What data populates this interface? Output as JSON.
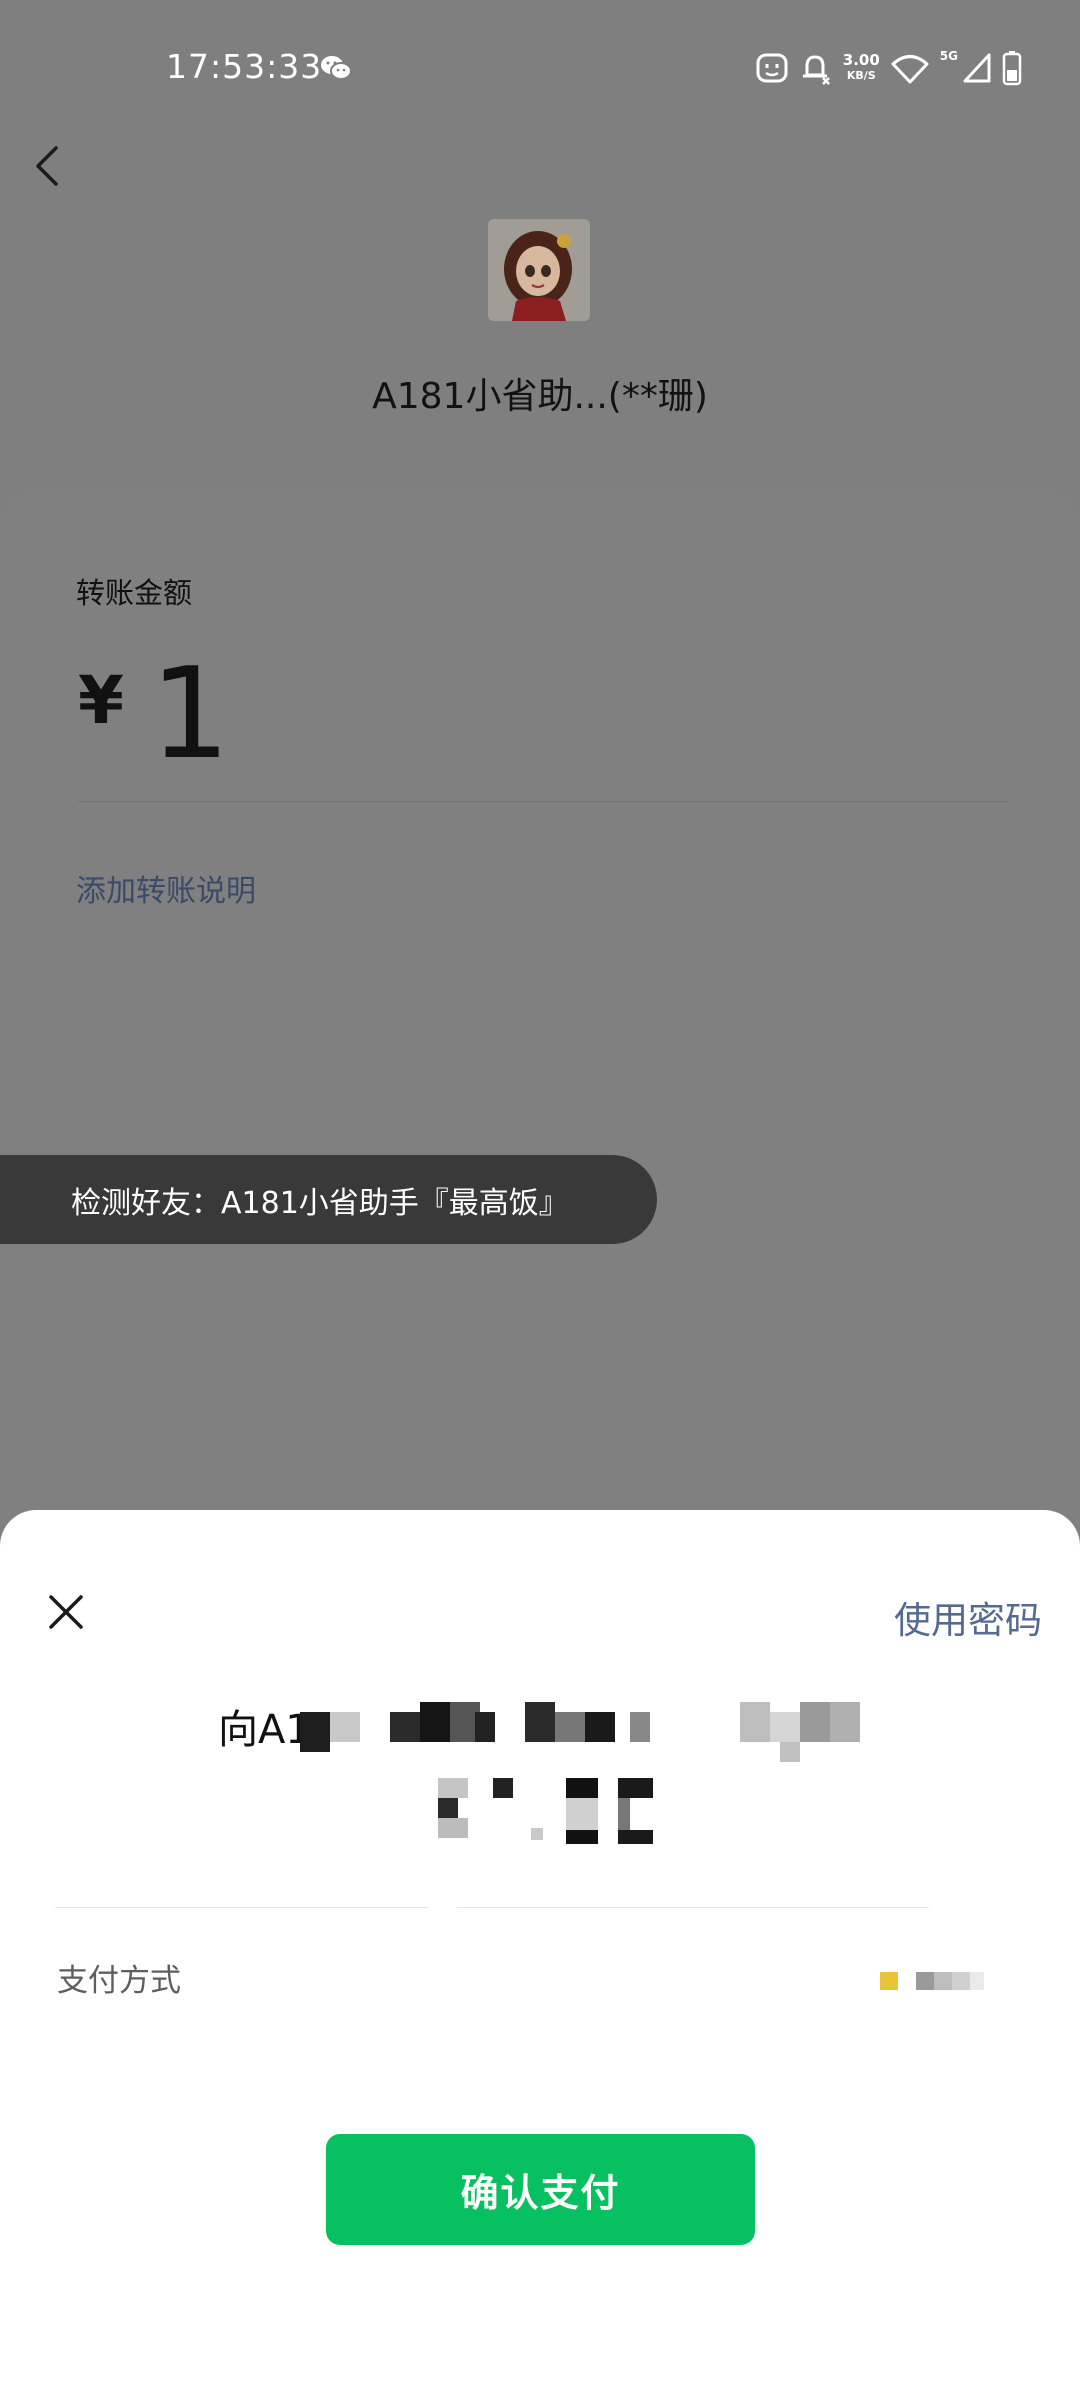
{
  "status_bar": {
    "time": "17:53:33",
    "net_speed_value": "3.00",
    "net_speed_unit": "KB/S",
    "network_type": "5G",
    "icons": [
      "wechat-icon",
      "face-icon",
      "bell-muted-icon",
      "wifi-icon",
      "signal-icon",
      "battery-icon"
    ]
  },
  "header": {
    "payee_name": "A181小省助...(**珊)"
  },
  "transfer": {
    "amount_label": "转账金额",
    "currency_symbol": "¥",
    "amount": "1",
    "add_note": "添加转账说明"
  },
  "toast": {
    "text": "检测好友：A181小省助手『最高饭』"
  },
  "pay_sheet": {
    "use_password": "使用密码",
    "transfer_to_prefix": "向A18",
    "payment_method_label": "支付方式",
    "confirm_button": "确认支付"
  },
  "colors": {
    "overlay": "#7f7f7f",
    "primary_green": "#07c160",
    "link_blue": "#556a8f",
    "toast_bg": "#393939"
  }
}
